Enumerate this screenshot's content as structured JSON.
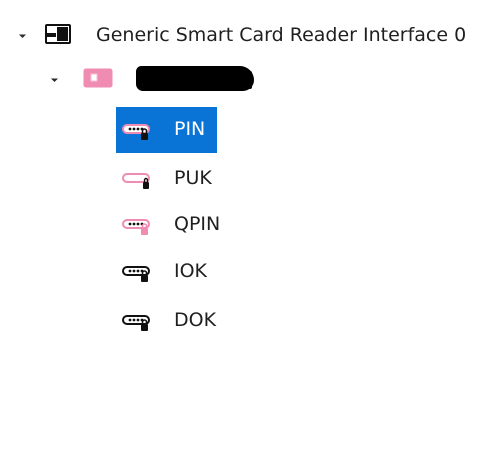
{
  "tree": {
    "root": {
      "label": "Generic Smart Card Reader Interface 0",
      "icon": "smart-card-reader-icon"
    },
    "card": {
      "icon": "smart-card-icon",
      "label_redacted": true,
      "color": "#f08bb1"
    },
    "items": [
      {
        "label": "PIN",
        "icon": "pin-key-icon",
        "selected": true
      },
      {
        "label": "PUK",
        "icon": "puk-key-icon",
        "selected": false
      },
      {
        "label": "QPIN",
        "icon": "qpin-key-icon",
        "selected": false
      },
      {
        "label": "IOK",
        "icon": "iok-key-icon",
        "selected": false
      },
      {
        "label": "DOK",
        "icon": "dok-key-icon",
        "selected": false
      }
    ]
  },
  "colors": {
    "selection": "#0a73d6",
    "pink_accent": "#f08bb1"
  }
}
